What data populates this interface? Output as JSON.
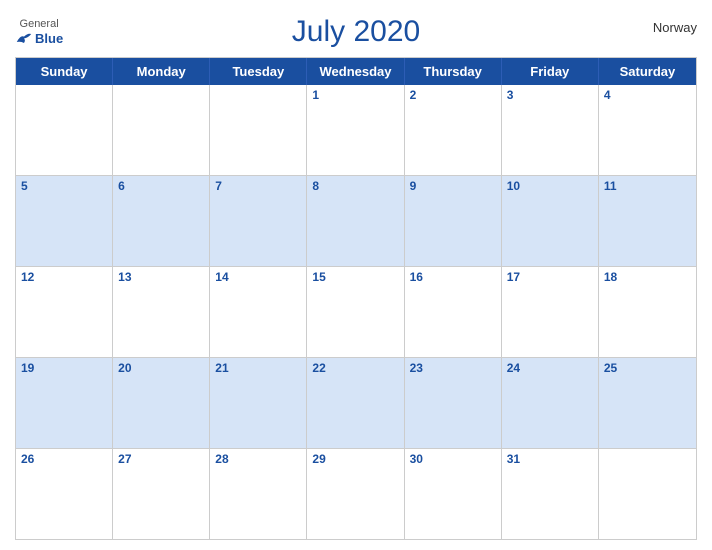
{
  "header": {
    "title": "July 2020",
    "country": "Norway",
    "logo_general": "General",
    "logo_blue": "Blue"
  },
  "days_of_week": [
    "Sunday",
    "Monday",
    "Tuesday",
    "Wednesday",
    "Thursday",
    "Friday",
    "Saturday"
  ],
  "weeks": [
    {
      "alt": false,
      "days": [
        {
          "num": "",
          "empty": true
        },
        {
          "num": "",
          "empty": true
        },
        {
          "num": "",
          "empty": true
        },
        {
          "num": "1",
          "empty": false
        },
        {
          "num": "2",
          "empty": false
        },
        {
          "num": "3",
          "empty": false
        },
        {
          "num": "4",
          "empty": false
        }
      ]
    },
    {
      "alt": true,
      "days": [
        {
          "num": "5",
          "empty": false
        },
        {
          "num": "6",
          "empty": false
        },
        {
          "num": "7",
          "empty": false
        },
        {
          "num": "8",
          "empty": false
        },
        {
          "num": "9",
          "empty": false
        },
        {
          "num": "10",
          "empty": false
        },
        {
          "num": "11",
          "empty": false
        }
      ]
    },
    {
      "alt": false,
      "days": [
        {
          "num": "12",
          "empty": false
        },
        {
          "num": "13",
          "empty": false
        },
        {
          "num": "14",
          "empty": false
        },
        {
          "num": "15",
          "empty": false
        },
        {
          "num": "16",
          "empty": false
        },
        {
          "num": "17",
          "empty": false
        },
        {
          "num": "18",
          "empty": false
        }
      ]
    },
    {
      "alt": true,
      "days": [
        {
          "num": "19",
          "empty": false
        },
        {
          "num": "20",
          "empty": false
        },
        {
          "num": "21",
          "empty": false
        },
        {
          "num": "22",
          "empty": false
        },
        {
          "num": "23",
          "empty": false
        },
        {
          "num": "24",
          "empty": false
        },
        {
          "num": "25",
          "empty": false
        }
      ]
    },
    {
      "alt": false,
      "days": [
        {
          "num": "26",
          "empty": false
        },
        {
          "num": "27",
          "empty": false
        },
        {
          "num": "28",
          "empty": false
        },
        {
          "num": "29",
          "empty": false
        },
        {
          "num": "30",
          "empty": false
        },
        {
          "num": "31",
          "empty": false
        },
        {
          "num": "",
          "empty": true
        }
      ]
    }
  ]
}
